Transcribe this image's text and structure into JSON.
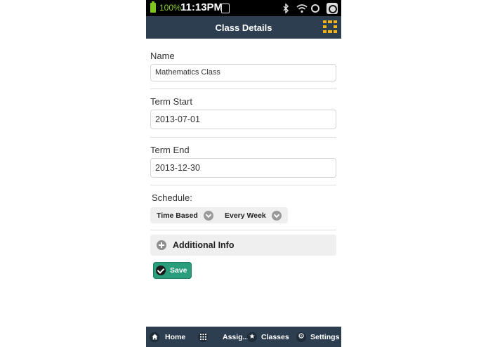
{
  "status_bar": {
    "battery": "100%",
    "time": "11:13PM"
  },
  "header": {
    "title": "Class Details",
    "menu_icon": "grid-menu-icon"
  },
  "form": {
    "name": {
      "label": "Name",
      "value": "Mathematics Class"
    },
    "term_start": {
      "label": "Term Start",
      "value": "2013-07-01"
    },
    "term_end": {
      "label": "Term End",
      "value": "2013-12-30"
    },
    "schedule": {
      "label": "Schedule:",
      "type_value": "Time Based",
      "frequency_value": "Every Week"
    },
    "additional_info": {
      "label": "Additional Info"
    },
    "save_label": "Save"
  },
  "bottom_nav": {
    "items": [
      {
        "label": "Home",
        "icon": "home-icon"
      },
      {
        "label": "Assig...",
        "icon": "grid-icon"
      },
      {
        "label": "Classes",
        "icon": "star-icon"
      },
      {
        "label": "Settings",
        "icon": "gear-icon"
      }
    ]
  },
  "colors": {
    "header_bg": "#2d3e50",
    "accent": "#2a9d7d",
    "menu_icon": "#f1b418"
  }
}
